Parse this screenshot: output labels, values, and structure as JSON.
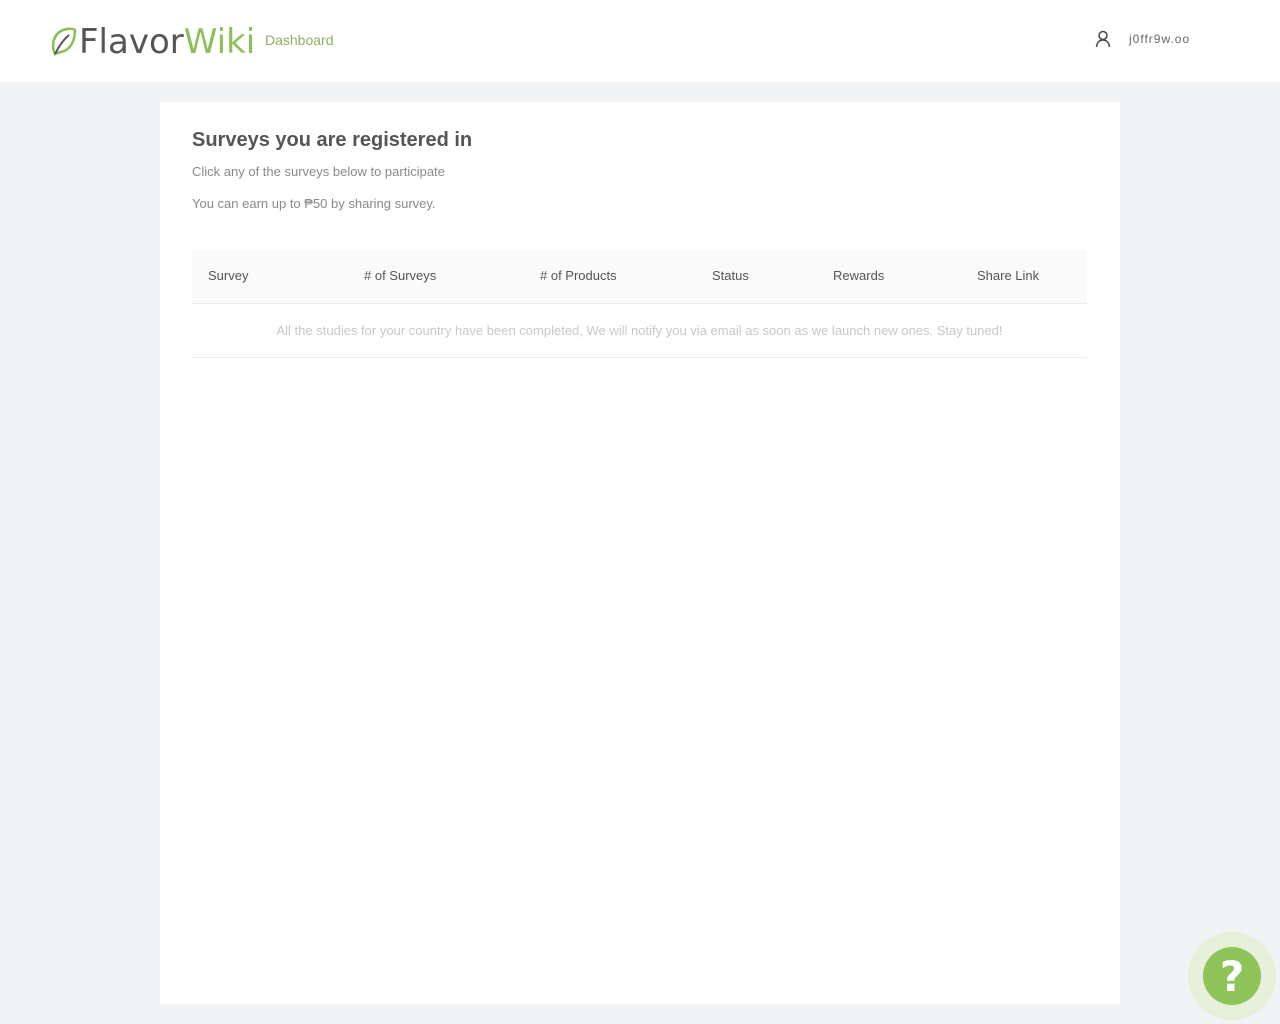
{
  "header": {
    "logo_flavor": "Flavor",
    "logo_wiki": "Wiki",
    "nav_dashboard": "Dashboard",
    "user_name": "j0ffr9w.oo"
  },
  "main": {
    "title": "Surveys you are registered in",
    "subtitle": "Click any of the surveys below to participate",
    "earn_text": "You can earn up to ₱50 by sharing survey.",
    "table": {
      "columns": [
        "Survey",
        "# of Surveys",
        "# of Products",
        "Status",
        "Rewards",
        "Share Link"
      ],
      "empty_message": "All the studies for your country have been completed, We will notify you via email as soon as we launch new ones. Stay tuned!"
    }
  },
  "help": {
    "label": "?"
  },
  "colors": {
    "brand_green": "#8fbf5a",
    "background": "#f2f3f5"
  }
}
